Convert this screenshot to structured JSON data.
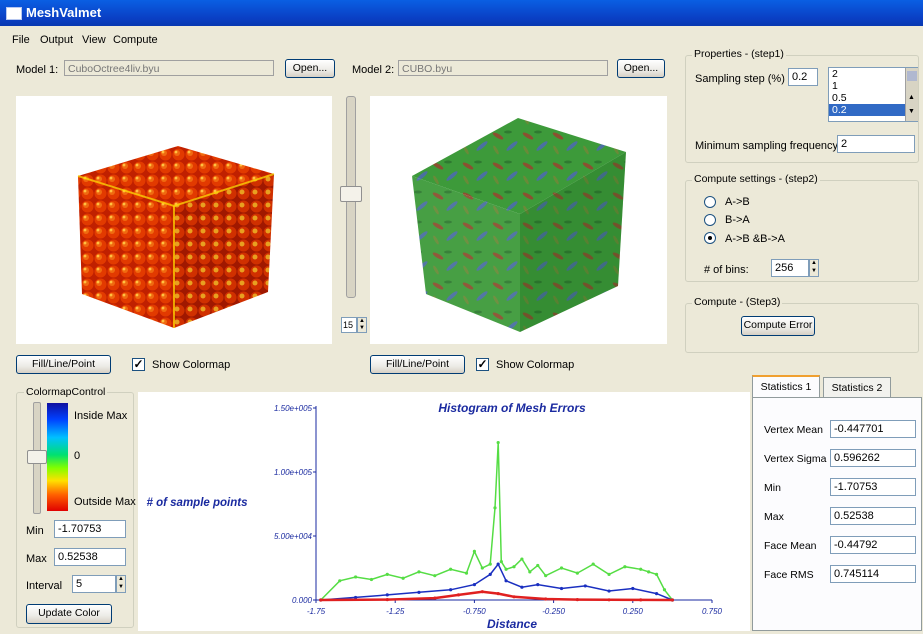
{
  "window": {
    "title": "MeshValmet"
  },
  "menu": [
    "File",
    "Output",
    "View",
    "Compute"
  ],
  "model1": {
    "label": "Model 1:",
    "file": "CuboOctree4liv.byu",
    "open_label": "Open..."
  },
  "model2": {
    "label": "Model 2:",
    "file": "CUBO.byu",
    "open_label": "Open..."
  },
  "slider": {
    "value": "15"
  },
  "viewer1": {
    "mode_button": "Fill/Line/Point",
    "show_colormap": "Show Colormap",
    "show_colormap_checked": true
  },
  "viewer2": {
    "mode_button": "Fill/Line/Point",
    "show_colormap": "Show Colormap",
    "show_colormap_checked": true
  },
  "properties": {
    "title": "Properties - (step1)",
    "sampling_label": "Sampling step (%)",
    "sampling_value": "0.2",
    "sampling_options": [
      "2",
      "1",
      "0.5",
      "0.2"
    ],
    "sampling_selected": "0.2",
    "min_freq_label": "Minimum sampling frequency",
    "min_freq_value": "2"
  },
  "compute_settings": {
    "title": "Compute settings - (step2)",
    "options": [
      "A->B",
      "B->A",
      "A->B &B->A"
    ],
    "selected": "A->B &B->A",
    "bins_label": "# of bins:",
    "bins_value": "256"
  },
  "compute": {
    "title": "Compute - (Step3)",
    "button": "Compute Error"
  },
  "colormap": {
    "title": "ColormapControl",
    "inside_max": "Inside Max",
    "zero": "0",
    "outside_max": "Outside Max",
    "min_label": "Min",
    "min_value": "-1.70753",
    "max_label": "Max",
    "max_value": "0.52538",
    "interval_label": "Interval",
    "interval_value": "5",
    "update_button": "Update Color"
  },
  "stats": {
    "tabs": [
      "Statistics 1",
      "Statistics 2"
    ],
    "active_tab": "Statistics 1",
    "rows": [
      {
        "label": "Vertex Mean",
        "value": "-0.447701"
      },
      {
        "label": "Vertex Sigma",
        "value": "0.596262"
      },
      {
        "label": "Min",
        "value": "-1.70753"
      },
      {
        "label": "Max",
        "value": "0.52538"
      },
      {
        "label": "Face Mean",
        "value": "-0.44792"
      },
      {
        "label": "Face RMS",
        "value": "0.745114"
      }
    ]
  },
  "chart_data": {
    "type": "line",
    "title": "Histogram of Mesh Errors",
    "xlabel": "Distance",
    "ylabel": "# of sample points",
    "xlim": [
      -1.75,
      0.75
    ],
    "ylim": [
      0,
      150000
    ],
    "x_ticks": [
      "-1.75",
      "-1.25",
      "-0.750",
      "-0.250",
      "0.250",
      "0.750"
    ],
    "y_ticks": [
      "0.000",
      "5.00e+004",
      "1.00e+005",
      "1.50e+005"
    ],
    "series": [
      {
        "color": "#55dd44",
        "x": [
          -1.72,
          -1.6,
          -1.5,
          -1.4,
          -1.3,
          -1.2,
          -1.1,
          -1.0,
          -0.9,
          -0.8,
          -0.75,
          -0.7,
          -0.65,
          -0.62,
          -0.6,
          -0.58,
          -0.55,
          -0.5,
          -0.45,
          -0.4,
          -0.35,
          -0.3,
          -0.2,
          -0.1,
          0.0,
          0.1,
          0.2,
          0.3,
          0.35,
          0.4,
          0.45,
          0.5
        ],
        "y": [
          0,
          15000,
          18000,
          16000,
          20000,
          17000,
          22000,
          19000,
          24000,
          21000,
          38000,
          25000,
          28000,
          72000,
          123000,
          30000,
          24000,
          26000,
          32000,
          22000,
          27000,
          19000,
          25000,
          21000,
          28000,
          20000,
          26000,
          24000,
          22000,
          20000,
          8000,
          0
        ]
      },
      {
        "color": "#1a2fc0",
        "x": [
          -1.72,
          -1.5,
          -1.3,
          -1.1,
          -0.9,
          -0.75,
          -0.65,
          -0.6,
          -0.55,
          -0.45,
          -0.35,
          -0.2,
          -0.05,
          0.1,
          0.25,
          0.4,
          0.5
        ],
        "y": [
          0,
          2000,
          4000,
          6000,
          8000,
          12000,
          20000,
          28000,
          15000,
          10000,
          12000,
          9000,
          11000,
          7000,
          9000,
          5000,
          0
        ]
      },
      {
        "color": "#e02020",
        "x": [
          -1.72,
          -1.3,
          -1.0,
          -0.85,
          -0.7,
          -0.6,
          -0.5,
          -0.3,
          -0.1,
          0.1,
          0.3,
          0.5
        ],
        "y": [
          0,
          300,
          1500,
          4000,
          6500,
          5000,
          2500,
          800,
          300,
          150,
          80,
          0
        ]
      }
    ]
  }
}
